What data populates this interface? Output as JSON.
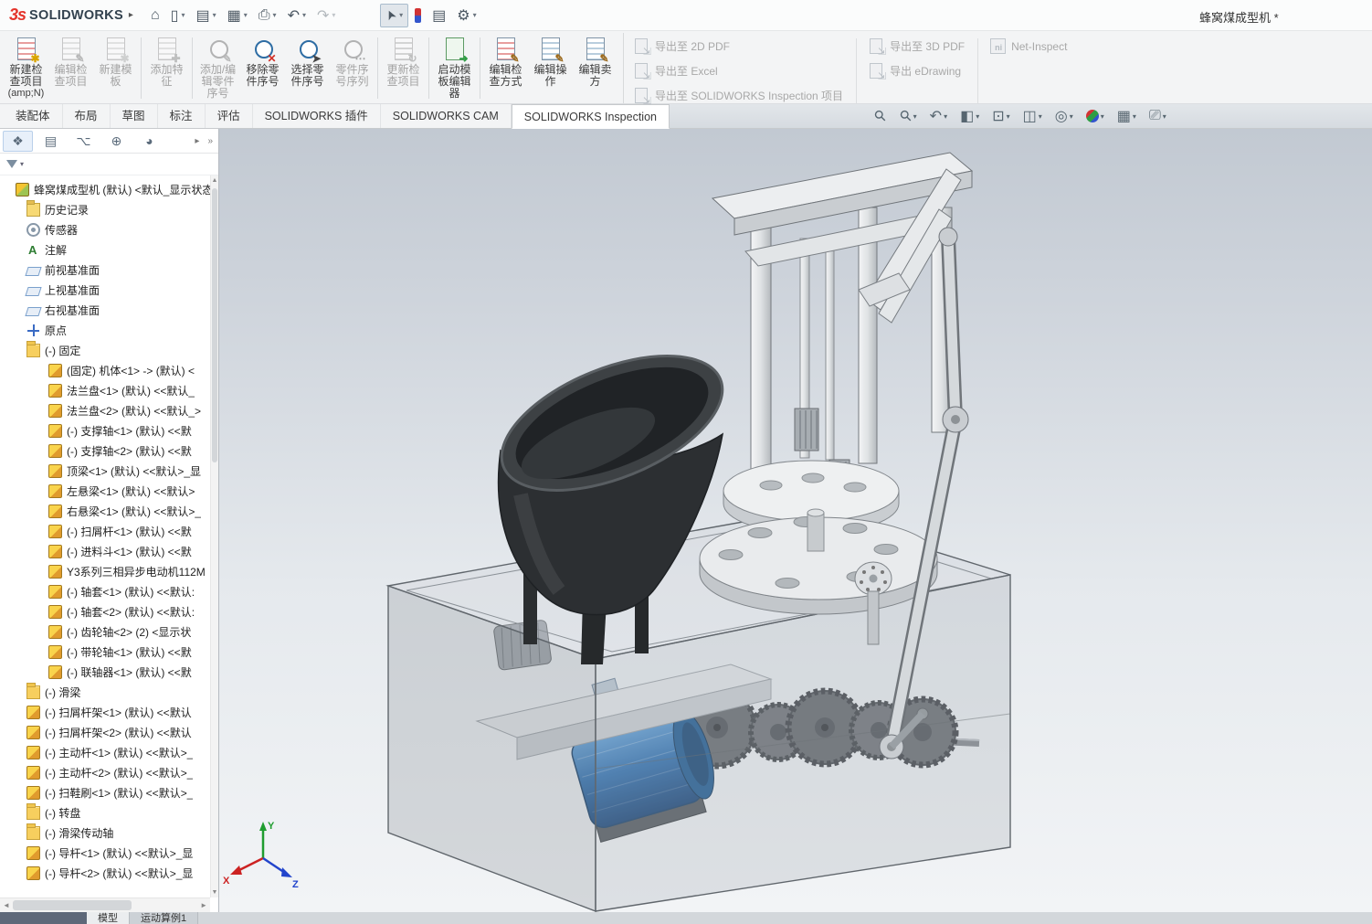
{
  "colors": {
    "brand_red": "#e4332a",
    "logo_text": "#33424f",
    "motor_blue": "#2a6cae",
    "hopper_dark": "#2e3134",
    "viewport_top": "#c2c9d2",
    "viewport_bottom": "#f2f4f6",
    "active_tab_bg": "#ffffff"
  },
  "titlebar": {
    "logo_mark": "3s",
    "app_name": "SOLIDWORKS",
    "flyout_glyph": "▸",
    "doc_title": "蜂窝煤成型机 *",
    "tools": [
      {
        "name": "home-icon",
        "glyph": "⌂"
      },
      {
        "name": "new-document-icon",
        "glyph": "▯",
        "caret": true
      },
      {
        "name": "open-document-icon",
        "glyph": "▤",
        "caret": true
      },
      {
        "name": "save-icon",
        "glyph": "▦",
        "caret": true
      },
      {
        "name": "print-icon",
        "glyph": "⎙",
        "caret": true
      },
      {
        "name": "undo-icon",
        "glyph": "↶",
        "caret": true
      },
      {
        "name": "redo-icon",
        "glyph": "↷",
        "caret": true,
        "disabled": true
      },
      {
        "name": "select-cursor-icon",
        "glyph": "➤",
        "caret": true,
        "pressed": true,
        "gap": true
      },
      {
        "name": "instant3d-icon",
        "glyph": ""
      },
      {
        "name": "command-list-icon",
        "glyph": "▤"
      },
      {
        "name": "options-gear-icon",
        "glyph": "⚙",
        "caret": true
      }
    ]
  },
  "ribbon": {
    "buttons": [
      {
        "type": "btn",
        "label": "新建检查项目",
        "sub": "(amp;N)",
        "icon": "new-inspection-project",
        "badge": "✱",
        "disabled": false
      },
      {
        "type": "btn",
        "label": "编辑检查项目",
        "icon": "edit-inspection-project",
        "badge": "✎",
        "disabled": true
      },
      {
        "type": "btn",
        "label": "新建模板",
        "icon": "new-template",
        "badge": "✱",
        "disabled": true
      },
      {
        "type": "sep"
      },
      {
        "type": "btn",
        "label": "添加特征",
        "icon": "add-characteristic",
        "badge": "✚",
        "disabled": true
      },
      {
        "type": "sep"
      },
      {
        "type": "btn",
        "label": "添加/编辑零件序号",
        "icon": "add-edit-balloon",
        "badge": "✎",
        "disabled": true
      },
      {
        "type": "btn",
        "label": "移除零件序号",
        "icon": "remove-balloon",
        "badge": "✕",
        "disabled": false
      },
      {
        "type": "btn",
        "label": "选择零件序号",
        "icon": "select-balloon",
        "badge": "➤",
        "disabled": false
      },
      {
        "type": "btn",
        "label": "零件序号序列",
        "icon": "balloon-sequence",
        "badge": "⋯",
        "disabled": true
      },
      {
        "type": "sep"
      },
      {
        "type": "btn",
        "label": "更新检查项目",
        "icon": "update-inspection-project",
        "badge": "↻",
        "disabled": true
      },
      {
        "type": "sep"
      },
      {
        "type": "btn",
        "label": "启动模板编辑器",
        "icon": "launch-template-editor",
        "badge": "➜",
        "disabled": false
      },
      {
        "type": "sep"
      },
      {
        "type": "btn",
        "label": "编辑检查方式",
        "icon": "edit-inspection-method",
        "badge": "✎",
        "disabled": false
      },
      {
        "type": "btn",
        "label": "编辑操作",
        "icon": "edit-operation",
        "badge": "✎",
        "disabled": false
      },
      {
        "type": "btn",
        "label": "编辑卖方",
        "icon": "edit-vendor",
        "badge": "✎",
        "disabled": false
      }
    ],
    "export_col1": [
      {
        "label": "导出至 2D PDF"
      },
      {
        "label": "导出至 Excel"
      },
      {
        "label": "导出至 SOLIDWORKS Inspection 项目"
      }
    ],
    "export_col2": [
      {
        "label": "导出至 3D PDF"
      },
      {
        "label": "导出 eDrawing"
      }
    ],
    "export_col3": [
      {
        "label": "Net-Inspect",
        "net": true
      }
    ]
  },
  "command_tabs": [
    {
      "label": "装配体"
    },
    {
      "label": "布局"
    },
    {
      "label": "草图"
    },
    {
      "label": "标注"
    },
    {
      "label": "评估"
    },
    {
      "label": "SOLIDWORKS 插件"
    },
    {
      "label": "SOLIDWORKS CAM"
    },
    {
      "label": "SOLIDWORKS Inspection",
      "active": true
    }
  ],
  "headsup": [
    {
      "name": "zoom-fit-icon",
      "glyph": "⚲"
    },
    {
      "name": "zoom-area-icon",
      "glyph": "⚲",
      "caret": true
    },
    {
      "name": "previous-view-icon",
      "glyph": "↶",
      "caret": true
    },
    {
      "name": "section-view-icon",
      "glyph": "◧",
      "caret": true
    },
    {
      "name": "view-orientation-icon",
      "glyph": "⊡",
      "caret": true
    },
    {
      "name": "display-style-icon",
      "glyph": "◫",
      "caret": true
    },
    {
      "name": "hide-show-items-icon",
      "glyph": "◎",
      "caret": true
    },
    {
      "name": "edit-appearance-icon",
      "glyph": "",
      "caret": true
    },
    {
      "name": "apply-scene-icon",
      "glyph": "▦",
      "caret": true
    },
    {
      "name": "view-settings-icon",
      "glyph": "⎚",
      "caret": true
    }
  ],
  "sidebar": {
    "tabs": [
      {
        "name": "feature-manager-tab",
        "glyph": "❖",
        "active": true
      },
      {
        "name": "property-manager-tab",
        "glyph": "▤"
      },
      {
        "name": "configuration-manager-tab",
        "glyph": "⌥"
      },
      {
        "name": "dimxpert-manager-tab",
        "glyph": "⊕"
      },
      {
        "name": "display-manager-tab",
        "glyph": "◕"
      }
    ],
    "tab_scroll_glyph": "▸",
    "tab_overflow_glyph": "»",
    "filter_caret": "▾",
    "scrollbar": {
      "up": "▲",
      "down": "▼",
      "left": "◄",
      "right": "►"
    }
  },
  "feature_tree": {
    "items": [
      {
        "lvl": 0,
        "arrow": "none",
        "icon": "assembly",
        "label": "蜂窝煤成型机 (默认) <默认_显示状态"
      },
      {
        "lvl": 1,
        "arrow": "none",
        "icon": "history",
        "label": "历史记录"
      },
      {
        "lvl": 1,
        "arrow": "none",
        "icon": "sensors",
        "label": "传感器"
      },
      {
        "lvl": 1,
        "arrow": "right",
        "icon": "annotations",
        "label": "注解"
      },
      {
        "lvl": 1,
        "arrow": "none",
        "icon": "plane",
        "label": "前视基准面"
      },
      {
        "lvl": 1,
        "arrow": "none",
        "icon": "plane",
        "label": "上视基准面"
      },
      {
        "lvl": 1,
        "arrow": "none",
        "icon": "plane",
        "label": "右视基准面"
      },
      {
        "lvl": 1,
        "arrow": "none",
        "icon": "origin",
        "label": "原点"
      },
      {
        "lvl": 1,
        "arrow": "down",
        "icon": "folder",
        "label": "(-) 固定"
      },
      {
        "lvl": 2,
        "arrow": "right",
        "icon": "part",
        "label": "(固定) 机体<1> -> (默认) <"
      },
      {
        "lvl": 2,
        "arrow": "right",
        "icon": "part",
        "label": "法兰盘<1> (默认) <<默认_"
      },
      {
        "lvl": 2,
        "arrow": "right",
        "icon": "part",
        "label": "法兰盘<2> (默认) <<默认_>"
      },
      {
        "lvl": 2,
        "arrow": "right",
        "icon": "part",
        "label": "(-) 支撑轴<1> (默认) <<默"
      },
      {
        "lvl": 2,
        "arrow": "right",
        "icon": "part",
        "label": "(-) 支撑轴<2> (默认) <<默"
      },
      {
        "lvl": 2,
        "arrow": "right",
        "icon": "part",
        "label": "顶梁<1> (默认) <<默认>_显"
      },
      {
        "lvl": 2,
        "arrow": "right",
        "icon": "part",
        "label": "左悬梁<1> (默认) <<默认>"
      },
      {
        "lvl": 2,
        "arrow": "right",
        "icon": "part",
        "label": "右悬梁<1> (默认) <<默认>_"
      },
      {
        "lvl": 2,
        "arrow": "right",
        "icon": "part",
        "label": "(-) 扫屑杆<1> (默认) <<默"
      },
      {
        "lvl": 2,
        "arrow": "right",
        "icon": "part",
        "label": "(-) 进料斗<1> (默认) <<默"
      },
      {
        "lvl": 2,
        "arrow": "right",
        "icon": "part",
        "label": "Y3系列三相异步电动机112M"
      },
      {
        "lvl": 2,
        "arrow": "right",
        "icon": "part",
        "label": "(-) 轴套<1> (默认) <<默认:"
      },
      {
        "lvl": 2,
        "arrow": "right",
        "icon": "part",
        "label": "(-) 轴套<2> (默认) <<默认:"
      },
      {
        "lvl": 2,
        "arrow": "right",
        "icon": "part",
        "label": "(-) 齿轮轴<2> (2) <显示状"
      },
      {
        "lvl": 2,
        "arrow": "right",
        "icon": "part",
        "label": "(-) 带轮轴<1> (默认) <<默"
      },
      {
        "lvl": 2,
        "arrow": "right",
        "icon": "part",
        "label": "(-) 联轴器<1> (默认) <<默"
      },
      {
        "lvl": 1,
        "arrow": "none",
        "icon": "folder",
        "label": "(-) 滑梁"
      },
      {
        "lvl": 1,
        "arrow": "right",
        "icon": "part",
        "label": "(-) 扫屑杆架<1> (默认) <<默认"
      },
      {
        "lvl": 1,
        "arrow": "right",
        "icon": "part",
        "label": "(-) 扫屑杆架<2> (默认) <<默认"
      },
      {
        "lvl": 1,
        "arrow": "right",
        "icon": "part",
        "label": "(-) 主动杆<1> (默认) <<默认>_"
      },
      {
        "lvl": 1,
        "arrow": "right",
        "icon": "part",
        "label": "(-) 主动杆<2> (默认) <<默认>_"
      },
      {
        "lvl": 1,
        "arrow": "right",
        "icon": "part",
        "label": "(-) 扫鞋刷<1> (默认) <<默认>_"
      },
      {
        "lvl": 1,
        "arrow": "none",
        "icon": "folder",
        "label": "(-) 转盘"
      },
      {
        "lvl": 1,
        "arrow": "none",
        "icon": "folder",
        "label": "(-) 滑梁传动轴"
      },
      {
        "lvl": 1,
        "arrow": "right",
        "icon": "part",
        "label": "(-) 导杆<1> (默认) <<默认>_显"
      },
      {
        "lvl": 1,
        "arrow": "right",
        "icon": "part",
        "label": "(-) 导杆<2> (默认) <<默认>_显"
      }
    ]
  },
  "viewport": {
    "triad": {
      "x": "X",
      "y": "Y",
      "z": "Z"
    }
  },
  "statusbar": {
    "tabs": [
      {
        "label": "模型",
        "active": true
      },
      {
        "label": "运动算例1",
        "active": false
      }
    ]
  }
}
